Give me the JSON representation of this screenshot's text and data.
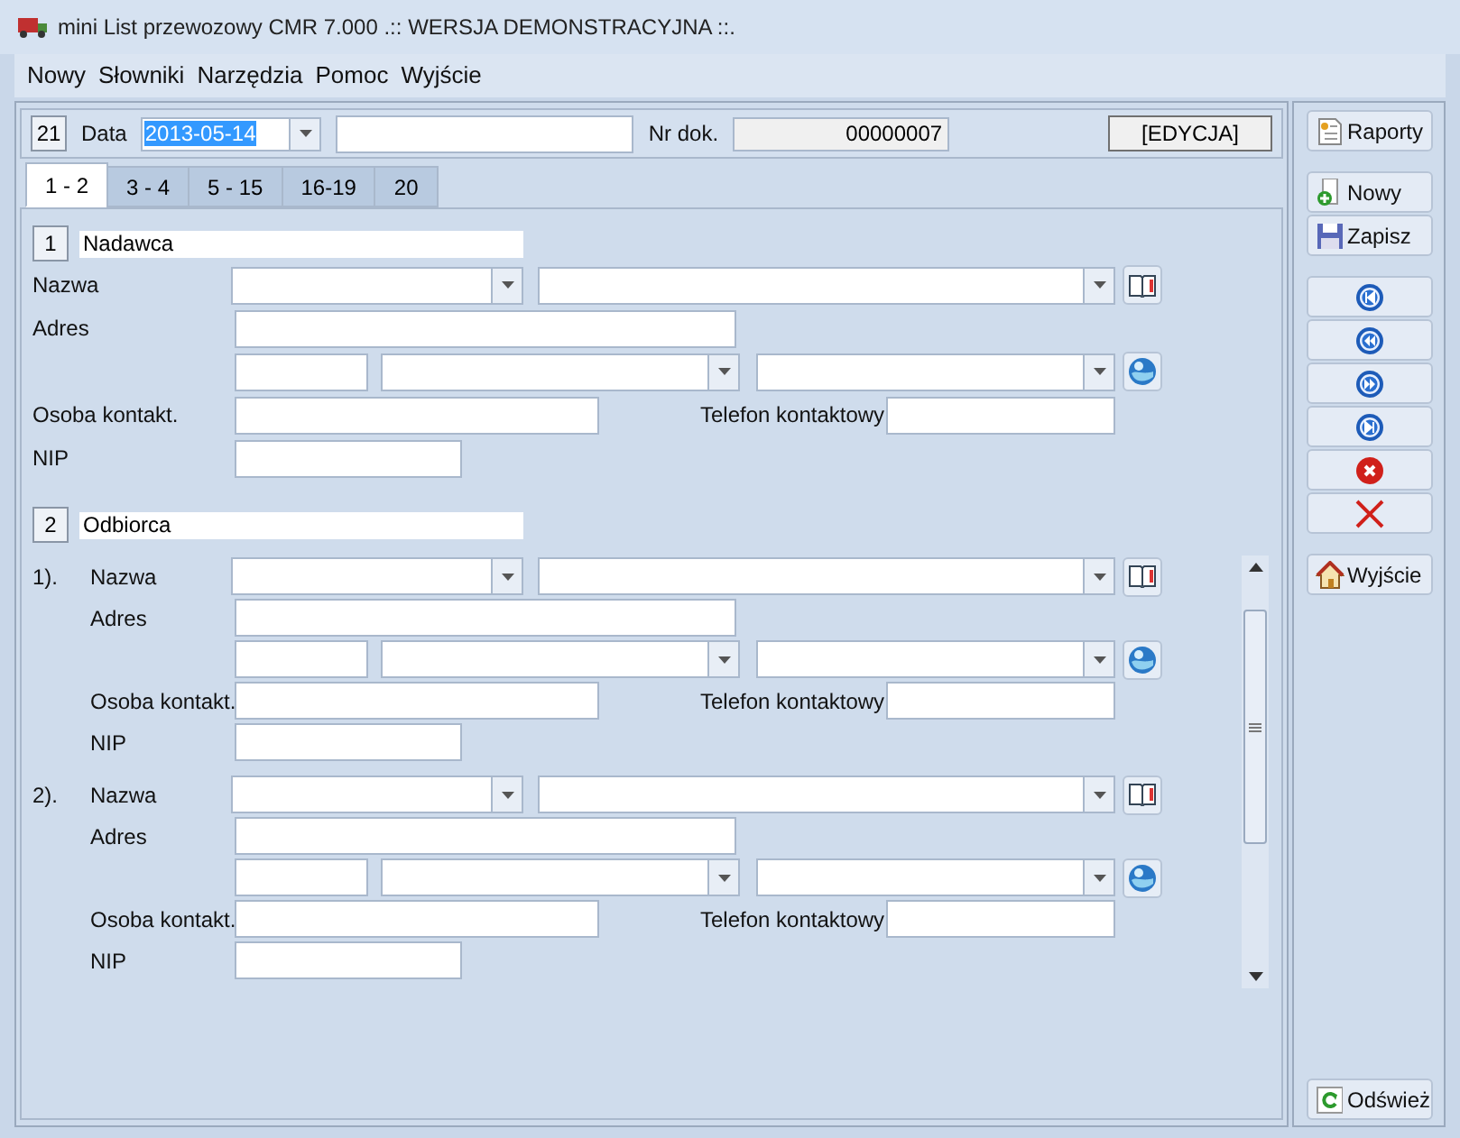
{
  "window": {
    "title": "mini List przewozowy CMR 7.000 .:: WERSJA DEMONSTRACYJNA ::."
  },
  "menu": [
    "Nowy",
    "Słowniki",
    "Narzędzia",
    "Pomoc",
    "Wyjście"
  ],
  "header": {
    "number": "21",
    "date_label": "Data",
    "date_value": "2013-05-14",
    "nr_label": "Nr dok.",
    "nr_value": "00000007",
    "mode": "[EDYCJA]"
  },
  "tabs": [
    {
      "label": "1 - 2",
      "selected": true
    },
    {
      "label": "3 - 4",
      "selected": false
    },
    {
      "label": "5 - 15",
      "selected": false
    },
    {
      "label": "16-19",
      "selected": false
    },
    {
      "label": "20",
      "selected": false
    }
  ],
  "sender": {
    "number": "1",
    "title": "Nadawca",
    "name": "Nazwa",
    "address": "Adres",
    "contact": "Osoba kontakt.",
    "phone": "Telefon kontaktowy",
    "nip": "NIP"
  },
  "recipient": {
    "number": "2",
    "title": "Odbiorca",
    "entries": [
      {
        "index": "1).",
        "name": "Nazwa",
        "address": "Adres",
        "contact": "Osoba kontakt.",
        "phone": "Telefon kontaktowy",
        "nip": "NIP"
      },
      {
        "index": "2).",
        "name": "Nazwa",
        "address": "Adres",
        "contact": "Osoba kontakt.",
        "phone": "Telefon kontaktowy",
        "nip": "NIP"
      }
    ]
  },
  "side_buttons": [
    {
      "kind": "report",
      "label": "Raporty"
    },
    {
      "kind": "gap"
    },
    {
      "kind": "new",
      "label": "Nowy"
    },
    {
      "kind": "save",
      "label": "Zapisz"
    },
    {
      "kind": "gap"
    },
    {
      "kind": "first"
    },
    {
      "kind": "prev"
    },
    {
      "kind": "next"
    },
    {
      "kind": "last"
    },
    {
      "kind": "delete"
    },
    {
      "kind": "cancel"
    },
    {
      "kind": "gap"
    },
    {
      "kind": "exit",
      "label": "Wyjście"
    },
    {
      "kind": "spacer"
    },
    {
      "kind": "refresh",
      "label": "Odśwież"
    }
  ]
}
